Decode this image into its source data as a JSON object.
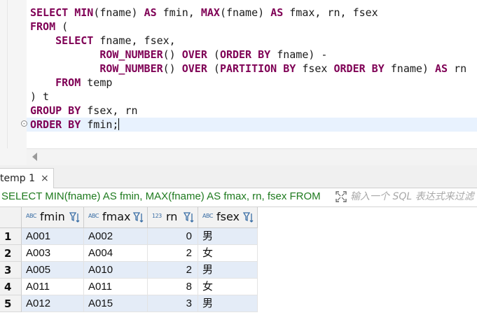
{
  "editor": {
    "lines": [
      [
        {
          "t": "SELECT",
          "k": 1
        },
        {
          "t": " "
        },
        {
          "t": "MIN",
          "k": 1
        },
        {
          "t": "(fname) "
        },
        {
          "t": "AS",
          "k": 1
        },
        {
          "t": " fmin, "
        },
        {
          "t": "MAX",
          "k": 1
        },
        {
          "t": "(fname) "
        },
        {
          "t": "AS",
          "k": 1
        },
        {
          "t": " fmax, rn, fsex"
        }
      ],
      [
        {
          "t": "FROM",
          "k": 1
        },
        {
          "t": " ("
        }
      ],
      [
        {
          "t": "    "
        },
        {
          "t": "SELECT",
          "k": 1
        },
        {
          "t": " fname, fsex,"
        }
      ],
      [
        {
          "t": "           "
        },
        {
          "t": "ROW_NUMBER",
          "k": 1
        },
        {
          "t": "() "
        },
        {
          "t": "OVER",
          "k": 1
        },
        {
          "t": " ("
        },
        {
          "t": "ORDER BY",
          "k": 1
        },
        {
          "t": " fname) -"
        }
      ],
      [
        {
          "t": "           "
        },
        {
          "t": "ROW_NUMBER",
          "k": 1
        },
        {
          "t": "() "
        },
        {
          "t": "OVER",
          "k": 1
        },
        {
          "t": " ("
        },
        {
          "t": "PARTITION BY",
          "k": 1
        },
        {
          "t": " fsex "
        },
        {
          "t": "ORDER BY",
          "k": 1
        },
        {
          "t": " fname) "
        },
        {
          "t": "AS",
          "k": 1
        },
        {
          "t": " rn"
        }
      ],
      [
        {
          "t": "    "
        },
        {
          "t": "FROM",
          "k": 1
        },
        {
          "t": " temp"
        }
      ],
      [
        {
          "t": ") t"
        }
      ],
      [
        {
          "t": "GROUP BY",
          "k": 1
        },
        {
          "t": " fsex, rn"
        }
      ],
      [
        {
          "t": "ORDER BY",
          "k": 1
        },
        {
          "t": " fmin;"
        }
      ]
    ],
    "fold_marker": "-"
  },
  "tab": {
    "label": "temp 1",
    "close": "×"
  },
  "query_bar": {
    "text": "SELECT MIN(fname) AS fmin, MAX(fname) AS fmax, rn, fsex FROM",
    "filter_placeholder": "输入一个 SQL 表达式来过滤"
  },
  "results": {
    "columns": [
      {
        "name": "fmin",
        "type_icon": "ABC"
      },
      {
        "name": "fmax",
        "type_icon": "ABC"
      },
      {
        "name": "rn",
        "type_icon": "123"
      },
      {
        "name": "fsex",
        "type_icon": "ABC"
      }
    ],
    "rows": [
      {
        "n": "1",
        "fmin": "A001",
        "fmax": "A002",
        "rn": "0",
        "fsex": "男"
      },
      {
        "n": "2",
        "fmin": "A003",
        "fmax": "A004",
        "rn": "2",
        "fsex": "女"
      },
      {
        "n": "3",
        "fmin": "A005",
        "fmax": "A010",
        "rn": "2",
        "fsex": "男"
      },
      {
        "n": "4",
        "fmin": "A011",
        "fmax": "A011",
        "rn": "8",
        "fsex": "女"
      },
      {
        "n": "5",
        "fmin": "A012",
        "fmax": "A015",
        "rn": "3",
        "fsex": "男"
      }
    ]
  },
  "colors": {
    "keyword": "#7f0055",
    "query_text": "#1e7a1e",
    "selected_row": "#e4ecf7"
  }
}
